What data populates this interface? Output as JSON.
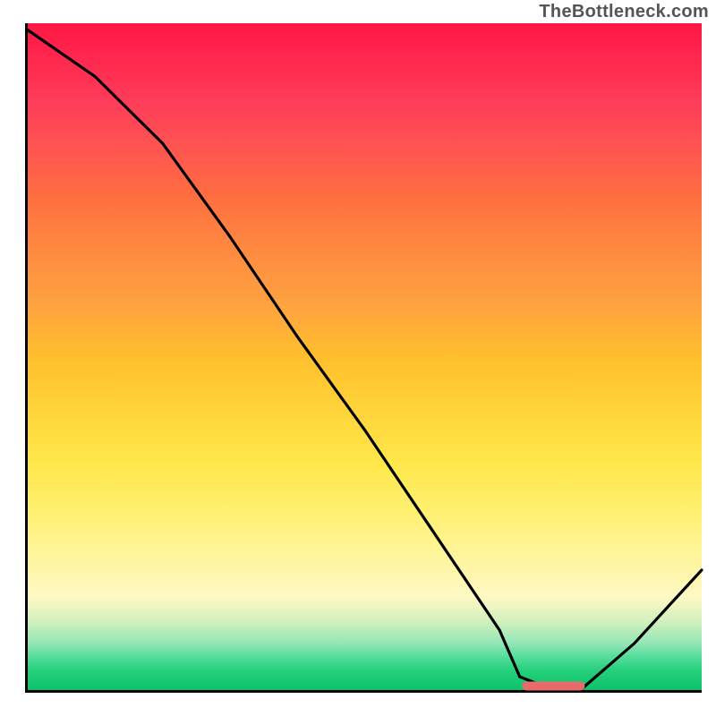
{
  "watermark": "TheBottleneck.com",
  "chart_data": {
    "type": "line",
    "title": "",
    "xlabel": "",
    "ylabel": "",
    "xlim": [
      0,
      100
    ],
    "ylim": [
      0,
      100
    ],
    "grid": false,
    "series": [
      {
        "name": "bottleneck-curve",
        "x": [
          0,
          10,
          20,
          30,
          40,
          50,
          60,
          70,
          73,
          78,
          82,
          90,
          100
        ],
        "y": [
          99,
          92,
          82,
          68,
          53,
          39,
          24,
          9,
          2,
          0,
          0,
          7,
          18
        ]
      }
    ],
    "marker": {
      "name": "optimal-range",
      "x_start": 74,
      "x_end": 82,
      "y": 0.6,
      "color": "#e86b6b"
    },
    "background_gradient": {
      "stops": [
        {
          "pct": 0,
          "color": "#ff1744"
        },
        {
          "pct": 20,
          "color": "#ff5252"
        },
        {
          "pct": 40,
          "color": "#ffa240"
        },
        {
          "pct": 60,
          "color": "#ffe84a"
        },
        {
          "pct": 80,
          "color": "#fff59d"
        },
        {
          "pct": 95,
          "color": "#55dd9c"
        },
        {
          "pct": 100,
          "color": "#0dc168"
        }
      ]
    }
  }
}
